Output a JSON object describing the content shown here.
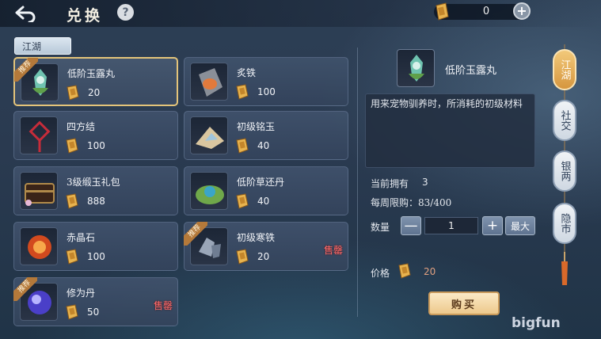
{
  "header": {
    "title": "兑换",
    "help_label": "?",
    "currency_amount": "0",
    "add_label": "+"
  },
  "category_tab": "江湖",
  "items": [
    {
      "name": "低阶玉露丸",
      "price": "20",
      "badge": "推荐",
      "sold_out": "",
      "icon": "jade-pill-icon",
      "selected": true
    },
    {
      "name": "炙铁",
      "price": "100",
      "badge": "",
      "sold_out": "",
      "icon": "scorched-iron-icon"
    },
    {
      "name": "四方结",
      "price": "100",
      "badge": "",
      "sold_out": "",
      "icon": "knot-icon"
    },
    {
      "name": "初级铭玉",
      "price": "40",
      "badge": "",
      "sold_out": "",
      "icon": "jade-powder-icon"
    },
    {
      "name": "3级缎玉礼包",
      "price": "888",
      "badge": "",
      "sold_out": "",
      "icon": "gift-chest-icon"
    },
    {
      "name": "低阶草还丹",
      "price": "40",
      "badge": "",
      "sold_out": "",
      "icon": "herb-pill-icon"
    },
    {
      "name": "赤晶石",
      "price": "100",
      "badge": "",
      "sold_out": "",
      "icon": "red-crystal-icon"
    },
    {
      "name": "初级寒铁",
      "price": "20",
      "badge": "推荐",
      "sold_out": "售罄",
      "icon": "cold-iron-icon"
    },
    {
      "name": "修为丹",
      "price": "50",
      "badge": "推荐",
      "sold_out": "售罄",
      "icon": "cultivation-pill-icon"
    }
  ],
  "detail": {
    "name": "低阶玉露丸",
    "description": "用来宠物驯养时，所消耗的初级材料",
    "owned_label": "当前拥有",
    "owned_value": "3",
    "limit_text": "每周限购：83/400",
    "quantity_label": "数量",
    "quantity_value": "1",
    "minus_label": "—",
    "plus_label": "+",
    "max_label": "最大",
    "price_label": "价格",
    "price_value": "20",
    "buy_label": "购买"
  },
  "side_tabs": [
    {
      "label": "江湖",
      "active": true
    },
    {
      "label": "社交",
      "active": false
    },
    {
      "label": "银两",
      "active": false
    },
    {
      "label": "隐市",
      "active": false
    }
  ],
  "watermark": "bigfun",
  "colors": {
    "selected_border": "#e4c47a",
    "sold_out": "#ff6a6a",
    "price_highlight": "#e0a080",
    "active_tab": "#d6963f"
  }
}
